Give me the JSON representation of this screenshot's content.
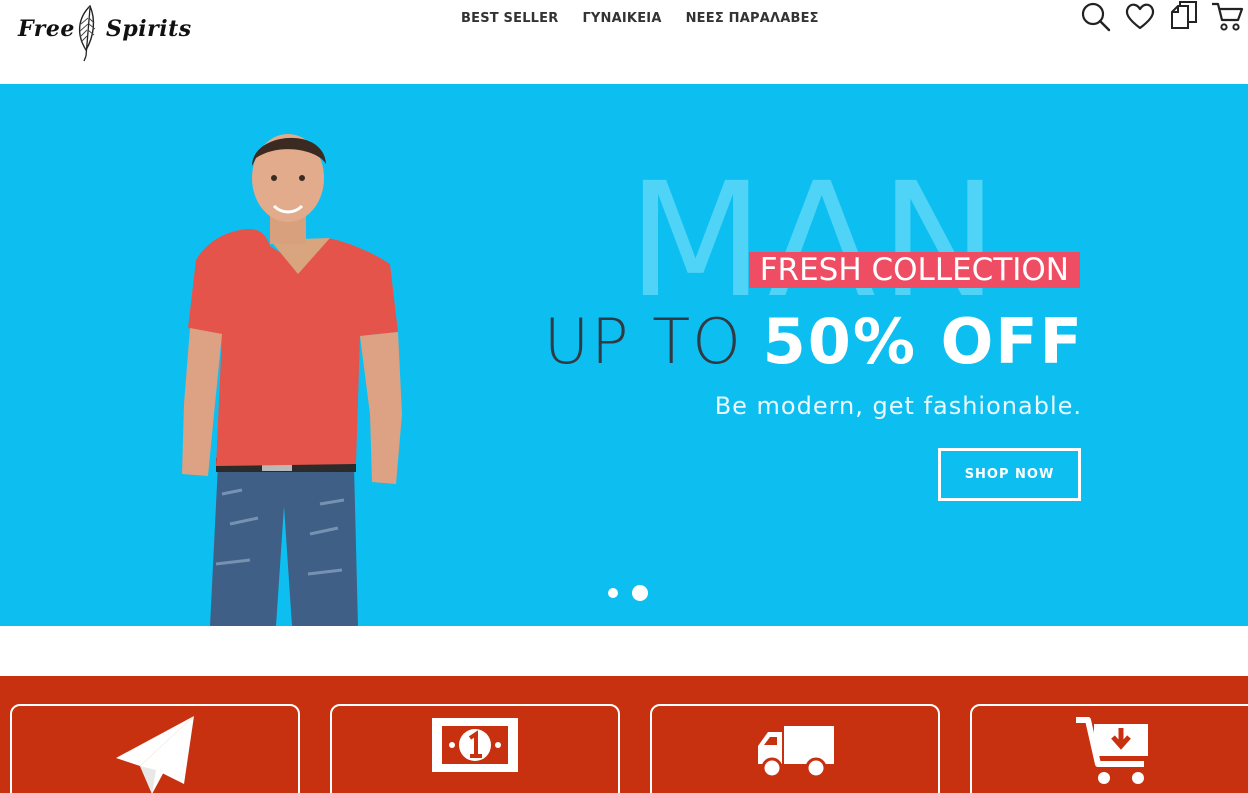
{
  "header": {
    "logo": {
      "word_1": "Free",
      "word_2": "Spirits",
      "icon": "feather-icon"
    },
    "nav": [
      {
        "label": "BEST SELLER"
      },
      {
        "label": "ΓΥΝΑΙΚΕΙΑ"
      },
      {
        "label": "ΝΕΕΣ ΠΑΡΑΛΑΒΕΣ"
      }
    ],
    "icons": [
      "search-icon",
      "heart-icon",
      "compare-icon",
      "cart-icon"
    ]
  },
  "hero": {
    "background_color": "#0dbff0",
    "background_word": "MAN",
    "tag": "FRESH COLLECTION",
    "tag_color": "#ee4d63",
    "headline_light": "UP TO",
    "headline_bold": "50% OFF",
    "subtitle": "Be modern, get fashionable.",
    "cta_label": "SHOP NOW",
    "slides_total": 2,
    "active_slide": 2
  },
  "features": {
    "background_color": "#c8310f",
    "icons": [
      "paper-plane-icon",
      "banknote-icon",
      "delivery-truck-icon",
      "cart-download-icon"
    ]
  }
}
